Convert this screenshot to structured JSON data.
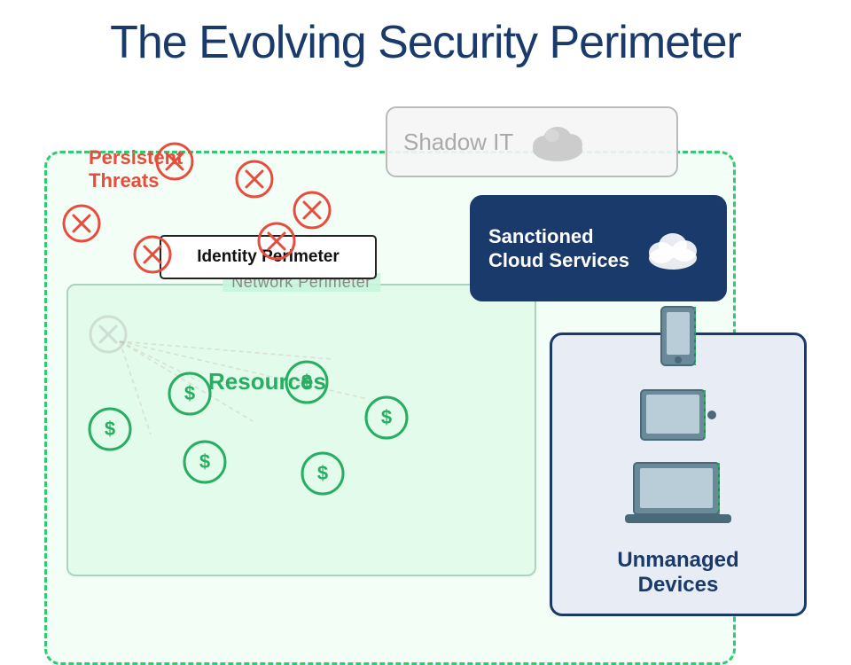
{
  "title": "The Evolving Security Perimeter",
  "labels": {
    "identity_perimeter": "Identity Perimeter",
    "network_perimeter": "Network Perimeter",
    "sanctioned_cloud": "Sanctioned\nCloud Services",
    "shadow_it": "Shadow IT",
    "unmanaged_devices": "Unmanaged\nDevices",
    "persistent_threats": "Persistent\nThreats",
    "resources": "Resources"
  },
  "colors": {
    "title": "#1a3a6b",
    "green_dashed": "#2ecc71",
    "threat_red": "#e74c3c",
    "resource_green": "#27ae60",
    "navy": "#1a3a6b",
    "device_color": "#5a7a8a"
  }
}
